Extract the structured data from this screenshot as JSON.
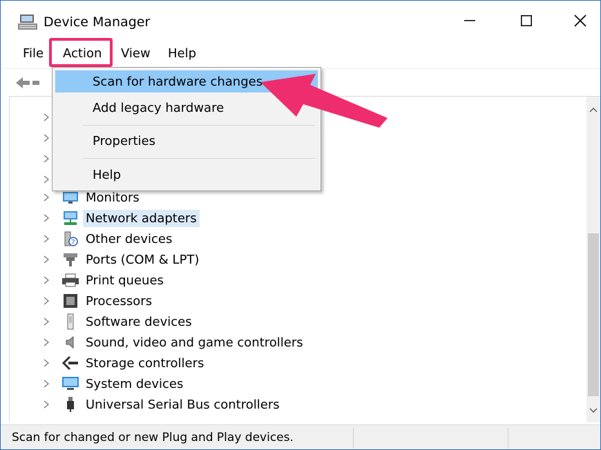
{
  "window": {
    "title": "Device Manager"
  },
  "controls": {
    "minimize": "—",
    "maximize": "☐",
    "close": "✕"
  },
  "menubar": {
    "file": "File",
    "action": "Action",
    "view": "View",
    "help": "Help"
  },
  "action_menu": {
    "items": [
      {
        "label": "Scan for hardware changes",
        "highlighted": true
      },
      {
        "label": "Add legacy hardware"
      },
      {
        "label": "Properties"
      },
      {
        "label": "Help"
      }
    ]
  },
  "tree": {
    "items": [
      {
        "label": "Monitors",
        "icon": "monitor-icon"
      },
      {
        "label": "Network adapters",
        "icon": "network-adapter-icon",
        "selected": true
      },
      {
        "label": "Other devices",
        "icon": "unknown-device-icon"
      },
      {
        "label": "Ports (COM & LPT)",
        "icon": "port-icon"
      },
      {
        "label": "Print queues",
        "icon": "printer-icon"
      },
      {
        "label": "Processors",
        "icon": "processor-icon"
      },
      {
        "label": "Software devices",
        "icon": "software-device-icon"
      },
      {
        "label": "Sound, video and game controllers",
        "icon": "speaker-icon"
      },
      {
        "label": "Storage controllers",
        "icon": "storage-controller-icon"
      },
      {
        "label": "System devices",
        "icon": "system-device-icon"
      },
      {
        "label": "Universal Serial Bus controllers",
        "icon": "usb-icon"
      }
    ]
  },
  "status": {
    "text": "Scan for changed or new Plug and Play devices."
  },
  "colors": {
    "highlight_border": "#ee2d6e",
    "menu_highlight": "#91c9f7",
    "selection": "#dbeaf8"
  }
}
